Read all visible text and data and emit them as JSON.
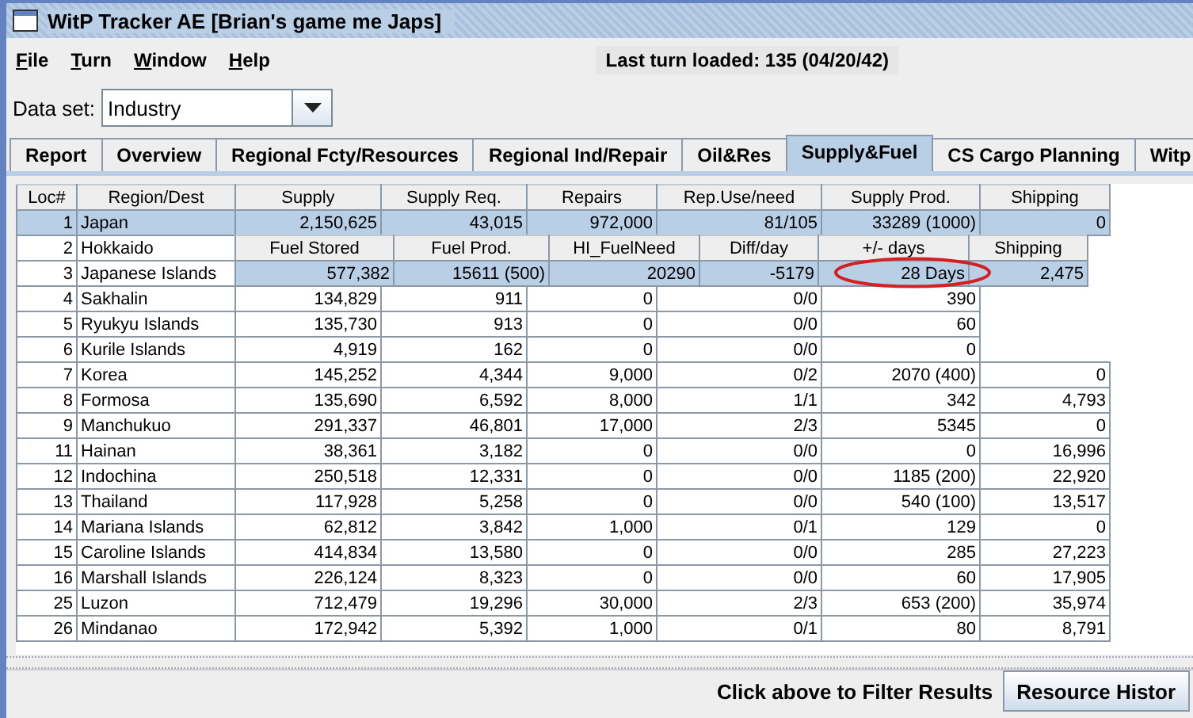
{
  "window": {
    "title": "WitP Tracker AE [Brian's game me Japs]"
  },
  "menu": [
    "File",
    "Turn",
    "Window",
    "Help"
  ],
  "status": "Last turn loaded: 135 (04/20/42)",
  "dataset": {
    "label": "Data set:",
    "value": "Industry"
  },
  "tabs": [
    {
      "label": "Report",
      "selected": false
    },
    {
      "label": "Overview",
      "selected": false
    },
    {
      "label": "Regional Fcty/Resources",
      "selected": false
    },
    {
      "label": "Regional Ind/Repair",
      "selected": false
    },
    {
      "label": "Oil&Res",
      "selected": false
    },
    {
      "label": "Supply&Fuel",
      "selected": true
    },
    {
      "label": "CS Cargo Planning",
      "selected": false
    },
    {
      "label": "Witp",
      "selected": false
    }
  ],
  "table": {
    "columns": [
      "Loc#",
      "Region/Dest",
      "Supply",
      "Supply Req.",
      "Repairs",
      "Rep.Use/need",
      "Supply Prod.",
      "Shipping"
    ],
    "rows": [
      {
        "cells": [
          "1",
          "Japan",
          "2,150,625",
          "43,015",
          "972,000",
          "81/105",
          "33289 (1000)",
          "0"
        ],
        "selected": true
      },
      {
        "cells": [
          "2",
          "Hokkaido"
        ],
        "selected": false
      },
      {
        "cells": [
          "3",
          "Japanese Islands"
        ],
        "selected": false
      },
      {
        "cells": [
          "4",
          "Sakhalin",
          "134,829",
          "911",
          "0",
          "0/0",
          "390"
        ],
        "selected": false
      },
      {
        "cells": [
          "5",
          "Ryukyu Islands",
          "135,730",
          "913",
          "0",
          "0/0",
          "60"
        ],
        "selected": false
      },
      {
        "cells": [
          "6",
          "Kurile Islands",
          "4,919",
          "162",
          "0",
          "0/0",
          "0"
        ],
        "selected": false
      },
      {
        "cells": [
          "7",
          "Korea",
          "145,252",
          "4,344",
          "9,000",
          "0/2",
          "2070 (400)",
          "0"
        ],
        "selected": false
      },
      {
        "cells": [
          "8",
          "Formosa",
          "135,690",
          "6,592",
          "8,000",
          "1/1",
          "342",
          "4,793"
        ],
        "selected": false
      },
      {
        "cells": [
          "9",
          "Manchukuo",
          "291,337",
          "46,801",
          "17,000",
          "2/3",
          "5345",
          "0"
        ],
        "selected": false
      },
      {
        "cells": [
          "11",
          "Hainan",
          "38,361",
          "3,182",
          "0",
          "0/0",
          "0",
          "16,996"
        ],
        "selected": false
      },
      {
        "cells": [
          "12",
          "Indochina",
          "250,518",
          "12,331",
          "0",
          "0/0",
          "1185 (200)",
          "22,920"
        ],
        "selected": false
      },
      {
        "cells": [
          "13",
          "Thailand",
          "117,928",
          "5,258",
          "0",
          "0/0",
          "540 (100)",
          "13,517"
        ],
        "selected": false
      },
      {
        "cells": [
          "14",
          "Mariana Islands",
          "62,812",
          "3,842",
          "1,000",
          "0/1",
          "129",
          "0"
        ],
        "selected": false
      },
      {
        "cells": [
          "15",
          "Caroline Islands",
          "414,834",
          "13,580",
          "0",
          "0/0",
          "285",
          "27,223"
        ],
        "selected": false
      },
      {
        "cells": [
          "16",
          "Marshall Islands",
          "226,124",
          "8,323",
          "0",
          "0/0",
          "60",
          "17,905"
        ],
        "selected": false
      },
      {
        "cells": [
          "25",
          "Luzon",
          "712,479",
          "19,296",
          "30,000",
          "2/3",
          "653 (200)",
          "35,974"
        ],
        "selected": false
      },
      {
        "cells": [
          "26",
          "Mindanao",
          "172,942",
          "5,392",
          "1,000",
          "0/1",
          "80",
          "8,791"
        ],
        "selected": false
      }
    ]
  },
  "overlay": {
    "columns": [
      "Fuel Stored",
      "Fuel Prod.",
      "HI_FuelNeed",
      "Diff/day",
      "+/- days",
      "Shipping"
    ],
    "rows": [
      {
        "cells": [
          "577,382",
          "15611 (500)",
          "20290",
          "-5179",
          "28 Days",
          "2,475"
        ],
        "selected": true
      }
    ]
  },
  "filter_hint": "Click above to Filter Results",
  "buttons": [
    "Resource Histor"
  ]
}
